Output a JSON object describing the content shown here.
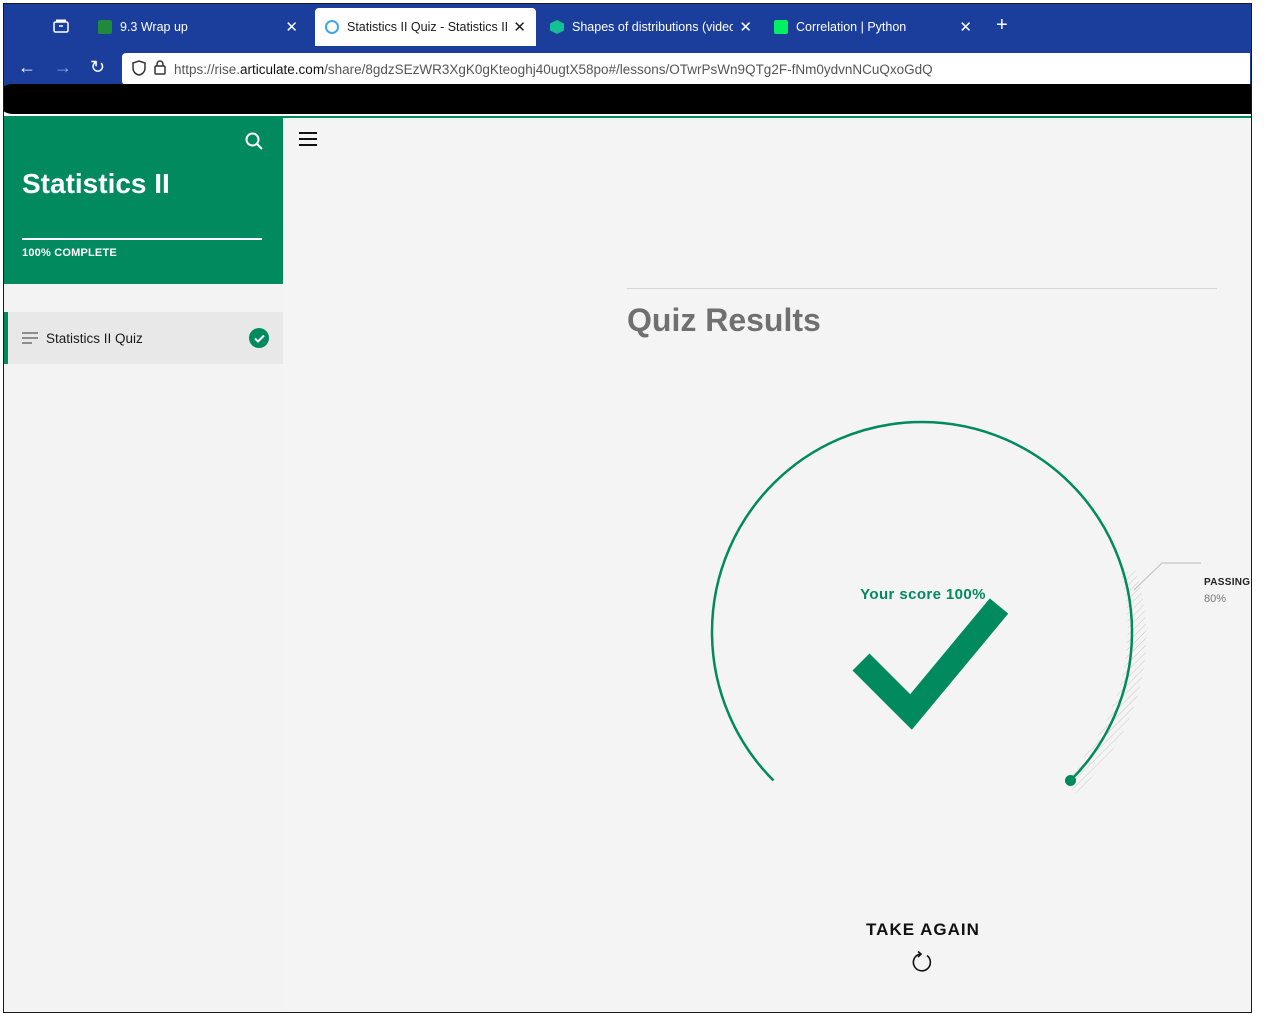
{
  "browser": {
    "tabs": [
      {
        "title": "9.3 Wrap up",
        "favicon_color": "#1f8a3a",
        "active": false
      },
      {
        "title": "Statistics II Quiz - Statistics II | R",
        "favicon_color": "#3fa7e8",
        "active": true
      },
      {
        "title": "Shapes of distributions (video) |",
        "favicon_color": "#14bf96",
        "active": false
      },
      {
        "title": "Correlation | Python",
        "favicon_color": "#03ef62",
        "active": false
      }
    ],
    "url_prefix": "https://rise.",
    "url_domain": "articulate.com",
    "url_path": "/share/8gdzSEzWR3XgK0gKteoghj40ugtX58po#/lessons/OTwrPsWn9QTg2F-fNm0ydvnNCuQxoGdQ"
  },
  "sidebar": {
    "course_title": "Statistics II",
    "progress_label": "100% COMPLETE",
    "progress_percent": 100,
    "lessons": [
      {
        "label": "Statistics II Quiz",
        "completed": true
      }
    ]
  },
  "main": {
    "heading": "Quiz Results",
    "score_label": "Your score 100%",
    "score_percent": 100,
    "passing_label": "PASSING",
    "passing_value": "80%",
    "take_again_label": "TAKE AGAIN"
  },
  "colors": {
    "brand": "#008a5e",
    "browser_chrome": "#1b3e9c"
  }
}
